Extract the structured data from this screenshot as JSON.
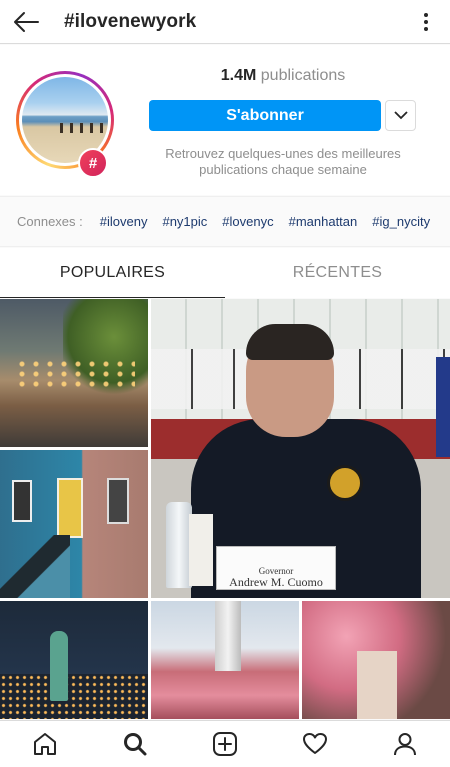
{
  "header": {
    "title": "#ilovenewyork",
    "back_icon": "arrow-left-icon",
    "more_icon": "more-vertical-icon"
  },
  "profile": {
    "badge": "#",
    "count": "1.4M",
    "count_label": "publications",
    "follow_label": "S'abonner",
    "description": "Retrouvez quelques-unes des meilleures publications chaque semaine",
    "accent_color": "#0095f6"
  },
  "related": {
    "label": "Connexes :",
    "tags": [
      "#iloveny",
      "#ny1pic",
      "#lovenyc",
      "#manhattan",
      "#ig_nycity"
    ]
  },
  "tabs": [
    {
      "label": "POPULAIRES",
      "active": true
    },
    {
      "label": "RÉCENTES",
      "active": false
    }
  ],
  "grid": {
    "placard_line1": "Governor",
    "placard_line2": "Andrew M. Cuomo"
  },
  "bottom_nav": [
    {
      "icon": "home-icon"
    },
    {
      "icon": "search-icon"
    },
    {
      "icon": "add-post-icon"
    },
    {
      "icon": "heart-icon"
    },
    {
      "icon": "profile-icon"
    }
  ]
}
